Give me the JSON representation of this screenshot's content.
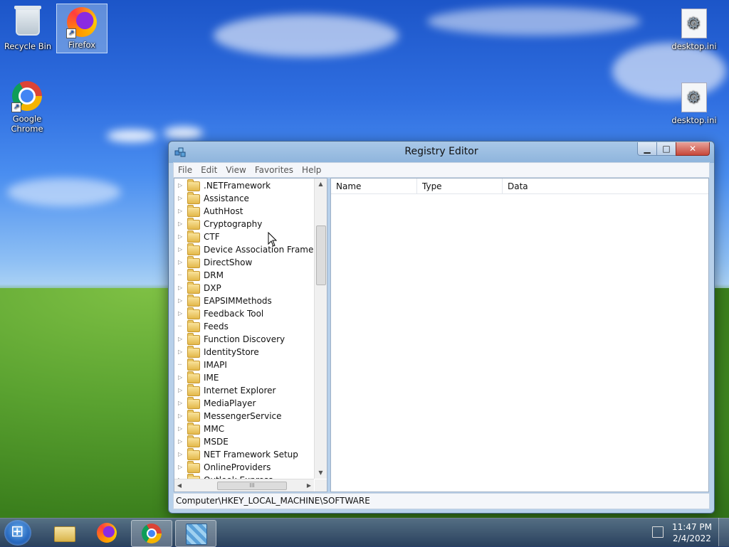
{
  "desktop": {
    "icons": [
      {
        "label": "Recycle Bin"
      },
      {
        "label": "Firefox"
      },
      {
        "label": "Google Chrome"
      },
      {
        "label": "desktop.ini"
      },
      {
        "label": "desktop.ini"
      }
    ]
  },
  "window": {
    "title": "Registry Editor",
    "controls": {
      "minimize": "▁",
      "maximize": "□",
      "close": "✕"
    },
    "menu": [
      "File",
      "Edit",
      "View",
      "Favorites",
      "Help"
    ],
    "tree": [
      {
        "label": ".NETFramework",
        "expandable": true
      },
      {
        "label": "Assistance",
        "expandable": true
      },
      {
        "label": "AuthHost",
        "expandable": true
      },
      {
        "label": "Cryptography",
        "expandable": true
      },
      {
        "label": "CTF",
        "expandable": true
      },
      {
        "label": "Device Association Framewor",
        "expandable": true
      },
      {
        "label": "DirectShow",
        "expandable": true
      },
      {
        "label": "DRM",
        "expandable": false
      },
      {
        "label": "DXP",
        "expandable": true
      },
      {
        "label": "EAPSIMMethods",
        "expandable": true
      },
      {
        "label": "Feedback Tool",
        "expandable": true
      },
      {
        "label": "Feeds",
        "expandable": false
      },
      {
        "label": "Function Discovery",
        "expandable": true
      },
      {
        "label": "IdentityStore",
        "expandable": true
      },
      {
        "label": "IMAPI",
        "expandable": false
      },
      {
        "label": "IME",
        "expandable": true
      },
      {
        "label": "Internet Explorer",
        "expandable": true
      },
      {
        "label": "MediaPlayer",
        "expandable": true
      },
      {
        "label": "MessengerService",
        "expandable": true
      },
      {
        "label": "MMC",
        "expandable": true
      },
      {
        "label": "MSDE",
        "expandable": true
      },
      {
        "label": "NET Framework Setup",
        "expandable": true
      },
      {
        "label": "OnlineProviders",
        "expandable": true
      },
      {
        "label": "Outlook Express",
        "expandable": true
      }
    ],
    "columns": [
      "Name",
      "Type",
      "Data"
    ],
    "status_path": "Computer\\HKEY_LOCAL_MACHINE\\SOFTWARE"
  },
  "taskbar": {
    "time": "11:47 PM",
    "date": "2/4/2022"
  }
}
